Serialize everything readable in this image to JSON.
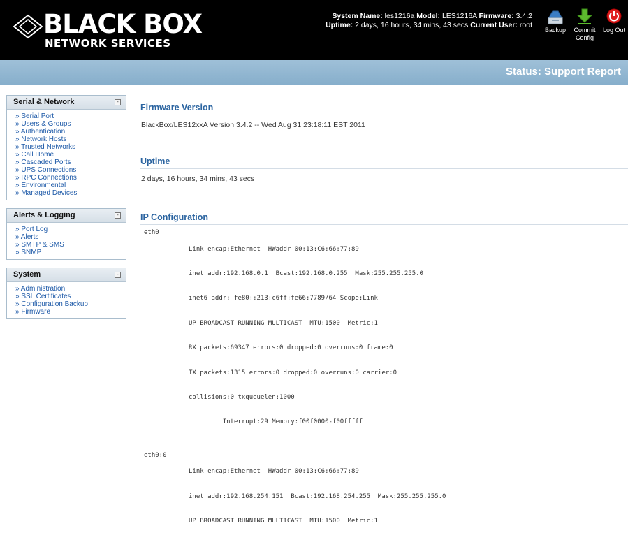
{
  "header": {
    "logo_main": "BLACK BOX",
    "logo_sub": "NETWORK SERVICES",
    "system_name_label": "System Name:",
    "system_name": "les1216a",
    "model_label": "Model:",
    "model": "LES1216A",
    "firmware_label": "Firmware:",
    "firmware": "3.4.2",
    "uptime_label": "Uptime:",
    "uptime": "2 days, 16 hours, 34 mins, 43 secs",
    "user_label": "Current User:",
    "user": "root",
    "buttons": {
      "backup": "Backup",
      "commit_1": "Commit",
      "commit_2": "Config",
      "logout": "Log Out"
    }
  },
  "banner": {
    "title": "Status: Support Report"
  },
  "sidebar": {
    "serial": {
      "title": "Serial & Network",
      "items": [
        "Serial Port",
        "Users & Groups",
        "Authentication",
        "Network Hosts",
        "Trusted Networks",
        "Call Home",
        "Cascaded Ports",
        "UPS Connections",
        "RPC Connections",
        "Environmental",
        "Managed Devices"
      ]
    },
    "alerts": {
      "title": "Alerts & Logging",
      "items": [
        "Port Log",
        "Alerts",
        "SMTP & SMS",
        "SNMP"
      ]
    },
    "system": {
      "title": "System",
      "items": [
        "Administration",
        "SSL Certificates",
        "Configuration Backup",
        "Firmware"
      ]
    },
    "toggle_symbol": "-"
  },
  "main": {
    "firmware": {
      "title": "Firmware Version",
      "text": "BlackBox/LES12xxA Version 3.4.2 -- Wed Aug 31 23:18:11 EST 2011"
    },
    "uptime": {
      "title": "Uptime",
      "text": "2 days, 16 hours, 34 mins, 43 secs"
    },
    "ip": {
      "title": "IP Configuration",
      "interfaces": [
        {
          "name": "eth0",
          "lines": [
            "Link encap:Ethernet  HWaddr 00:13:C6:66:77:89",
            "inet addr:192.168.0.1  Bcast:192.168.0.255  Mask:255.255.255.0",
            "inet6 addr: fe80::213:c6ff:fe66:7789/64 Scope:Link",
            "UP BROADCAST RUNNING MULTICAST  MTU:1500  Metric:1",
            "RX packets:69347 errors:0 dropped:0 overruns:0 frame:0",
            "TX packets:1315 errors:0 dropped:0 overruns:0 carrier:0",
            "collisions:0 txqueuelen:1000",
            "         Interrupt:29 Memory:f00f0000-f00fffff"
          ]
        },
        {
          "name": "eth0:0",
          "lines": [
            "Link encap:Ethernet  HWaddr 00:13:C6:66:77:89",
            "inet addr:192.168.254.151  Bcast:192.168.254.255  Mask:255.255.255.0",
            "UP BROADCAST RUNNING MULTICAST  MTU:1500  Metric:1"
          ]
        }
      ]
    }
  }
}
